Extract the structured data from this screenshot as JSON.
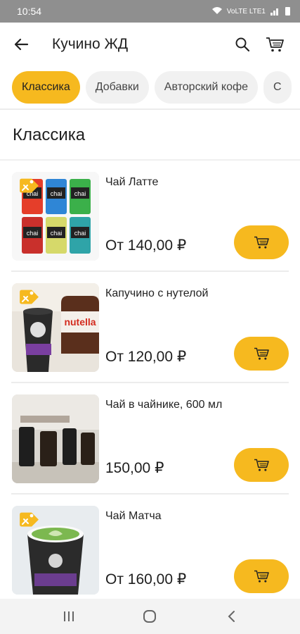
{
  "status_bar": {
    "time": "10:54",
    "network": "VoLTE LTE1"
  },
  "header": {
    "title": "Кучино ЖД",
    "back_icon": "arrow-left-icon",
    "search_icon": "search-icon",
    "cart_icon": "cart-icon"
  },
  "categories": [
    {
      "label": "Классика",
      "active": true
    },
    {
      "label": "Добавки",
      "active": false
    },
    {
      "label": "Авторский кофе",
      "active": false
    },
    {
      "label": "С",
      "active": false
    }
  ],
  "section": {
    "title": "Классика"
  },
  "products": [
    {
      "name": "Чай Латте",
      "price": "От 140,00 ₽",
      "cashback_badge": true
    },
    {
      "name": "Капучино с нутелой",
      "price": "От 120,00 ₽",
      "cashback_badge": true
    },
    {
      "name": "Чай в чайнике, 600 мл",
      "price": "150,00 ₽",
      "cashback_badge": false
    },
    {
      "name": "Чай Матча",
      "price": "От 160,00 ₽",
      "cashback_badge": true
    }
  ],
  "product_image_text": {
    "chai": "chai",
    "nutella": "nutella"
  },
  "colors": {
    "accent": "#f6b91f",
    "chip_inactive": "#f1f1f1",
    "status_bar": "#8f8f8f",
    "nav_bar": "#f3f3f3"
  }
}
